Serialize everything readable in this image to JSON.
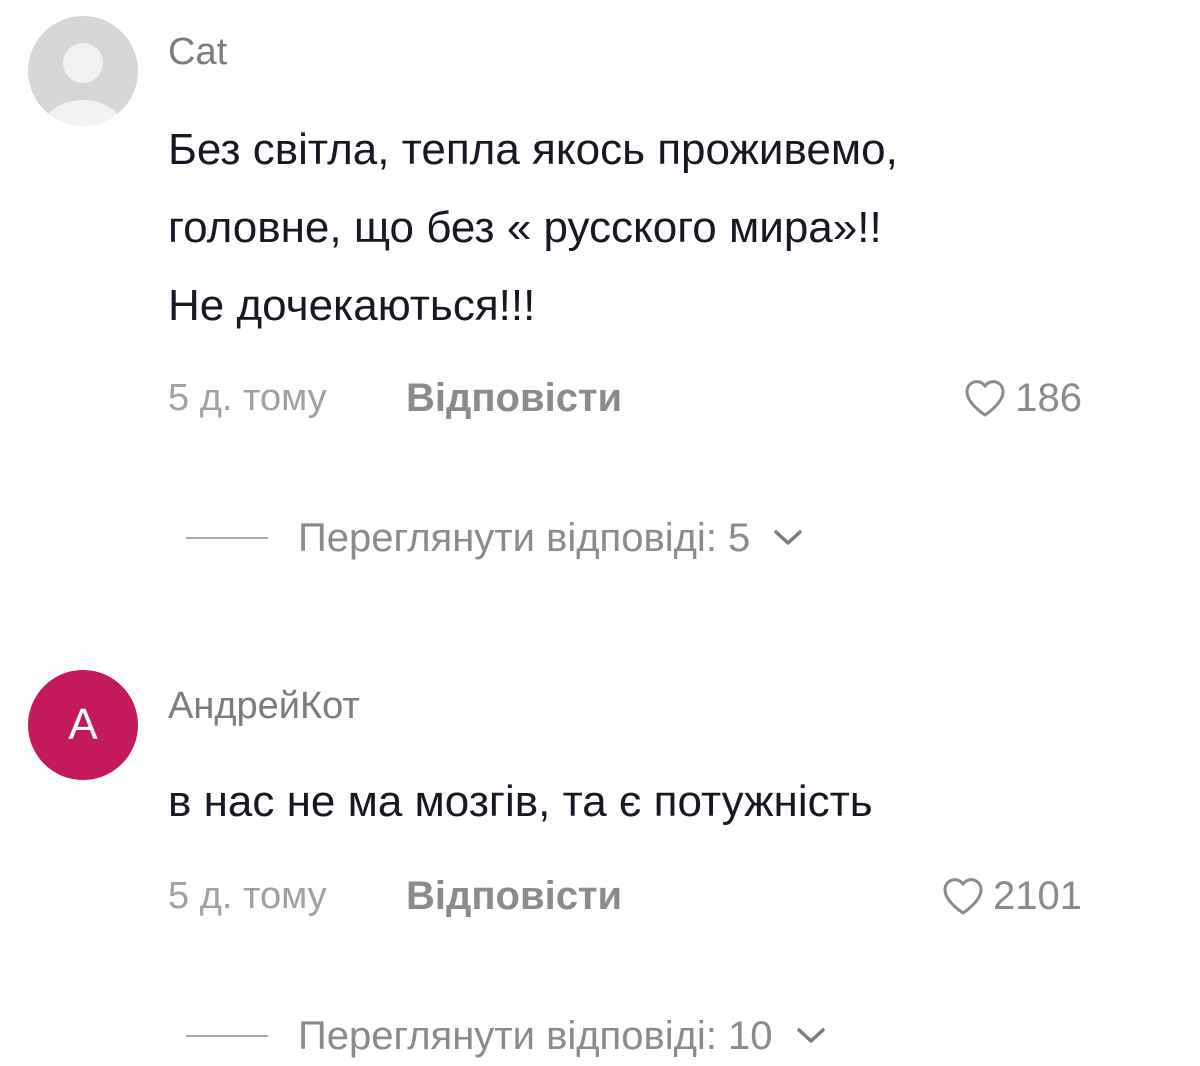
{
  "comments": [
    {
      "username": "Cat",
      "avatar": "default-user-icon",
      "text_lines": [
        "Без світла, тепла якось проживемо,",
        "головне, що без « русского мира»!!",
        "Не дочекаються!!!"
      ],
      "time": "5 д. тому",
      "reply_label": "Відповісти",
      "likes": "186",
      "view_replies_label": "Переглянути відповіді: 5"
    },
    {
      "username": "АндрейКот",
      "avatar_letter": "A",
      "avatar_color": "#c4195a",
      "text_lines": [
        "в нас не ма мозгів, та є потужність"
      ],
      "time": "5 д. тому",
      "reply_label": "Відповісти",
      "likes": "2101",
      "view_replies_label": "Переглянути відповіді: 10"
    }
  ],
  "icons": {
    "like": "heart-outline-icon",
    "expand": "chevron-down-icon"
  }
}
